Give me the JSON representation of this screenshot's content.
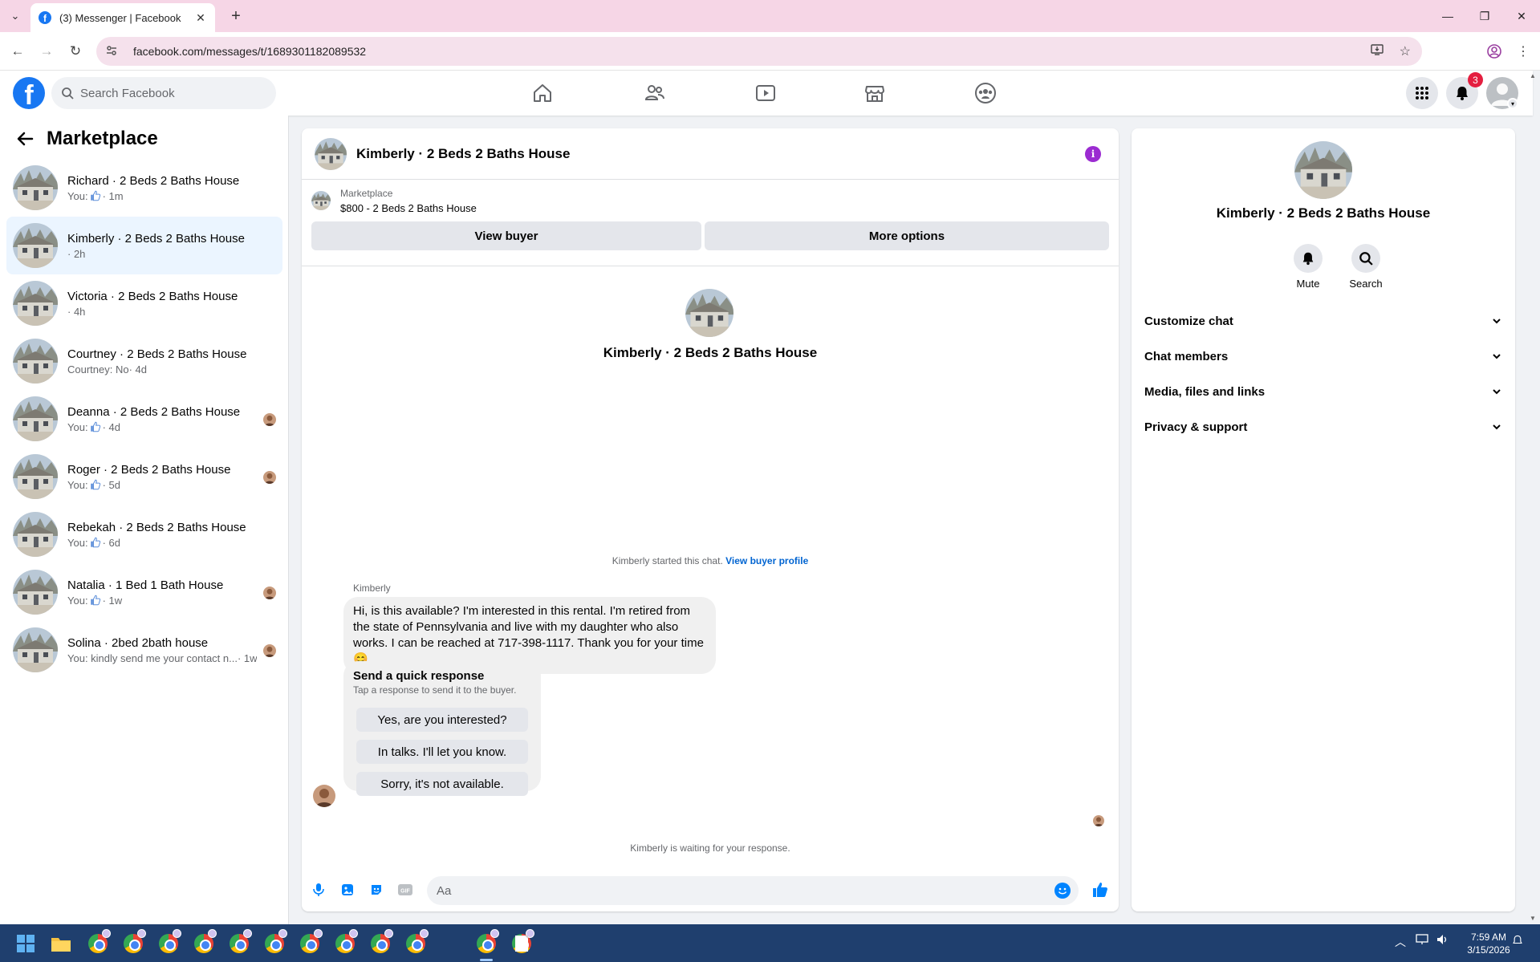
{
  "browser": {
    "tab_title": "(3) Messenger | Facebook",
    "url": "facebook.com/messages/t/1689301182089532"
  },
  "header": {
    "search_placeholder": "Search Facebook",
    "notification_count": "3"
  },
  "sidebar": {
    "title": "Marketplace",
    "conversations": [
      {
        "name": "Richard · 2 Beds 2 Baths House",
        "prefix": "You:",
        "like": true,
        "time": "· 1m",
        "active": false,
        "seen": false
      },
      {
        "name": "Kimberly · 2 Beds 2 Baths House",
        "prefix": "",
        "like": false,
        "time": "· 2h",
        "active": true,
        "seen": false
      },
      {
        "name": "Victoria · 2 Beds 2 Baths House",
        "prefix": "",
        "like": false,
        "time": "· 4h",
        "active": false,
        "seen": false
      },
      {
        "name": "Courtney · 2 Beds 2 Baths House",
        "prefix": "Courtney: No",
        "like": false,
        "time": "· 4d",
        "active": false,
        "seen": false
      },
      {
        "name": "Deanna · 2 Beds 2 Baths House",
        "prefix": "You:",
        "like": true,
        "time": "· 4d",
        "active": false,
        "seen": true
      },
      {
        "name": "Roger · 2 Beds 2 Baths House",
        "prefix": "You:",
        "like": true,
        "time": "· 5d",
        "active": false,
        "seen": true
      },
      {
        "name": "Rebekah · 2 Beds 2 Baths House",
        "prefix": "You:",
        "like": true,
        "time": "· 6d",
        "active": false,
        "seen": false
      },
      {
        "name": "Natalia · 1 Bed 1 Bath House",
        "prefix": "You:",
        "like": true,
        "time": "· 1w",
        "active": false,
        "seen": true
      },
      {
        "name": "Solina · 2bed 2bath house",
        "prefix": "You: kindly send me your contact n...",
        "like": false,
        "time": "· 1w",
        "active": false,
        "seen": true
      }
    ]
  },
  "chat": {
    "title": "Kimberly · 2 Beds 2 Baths House",
    "listing_category": "Marketplace",
    "listing_desc": "$800 - 2 Beds 2 Baths House",
    "view_buyer": "View buyer",
    "more_options": "More options",
    "intro_title": "Kimberly · 2 Beds 2 Baths House",
    "started_text": "Kimberly started this chat.",
    "view_buyer_profile": "View buyer profile",
    "sender": "Kimberly",
    "message": "Hi, is this available? I'm interested in this rental. I'm retired from the state of Pennsylvania and live with my daughter who also works. I can be reached at 717-398-1117. Thank you for your time 😊.",
    "quick_title": "Send a quick response",
    "quick_sub": "Tap a response to send it to the buyer.",
    "quick_responses": [
      "Yes, are you interested?",
      "In talks. I'll let you know.",
      "Sorry, it's not available."
    ],
    "waiting": "Kimberly is waiting for your response.",
    "composer_placeholder": "Aa"
  },
  "right_panel": {
    "title": "Kimberly · 2 Beds 2 Baths House",
    "mute": "Mute",
    "search": "Search",
    "sections": [
      "Customize chat",
      "Chat members",
      "Media, files and links",
      "Privacy & support"
    ]
  },
  "taskbar": {
    "time": "7:59 AM",
    "date": "3/15/2026"
  },
  "colors": {
    "fb_blue": "#1877f2",
    "active_row": "#ebf5ff",
    "link": "#0064d1",
    "info": "#9b2bd1",
    "badge": "#e41e3f"
  }
}
